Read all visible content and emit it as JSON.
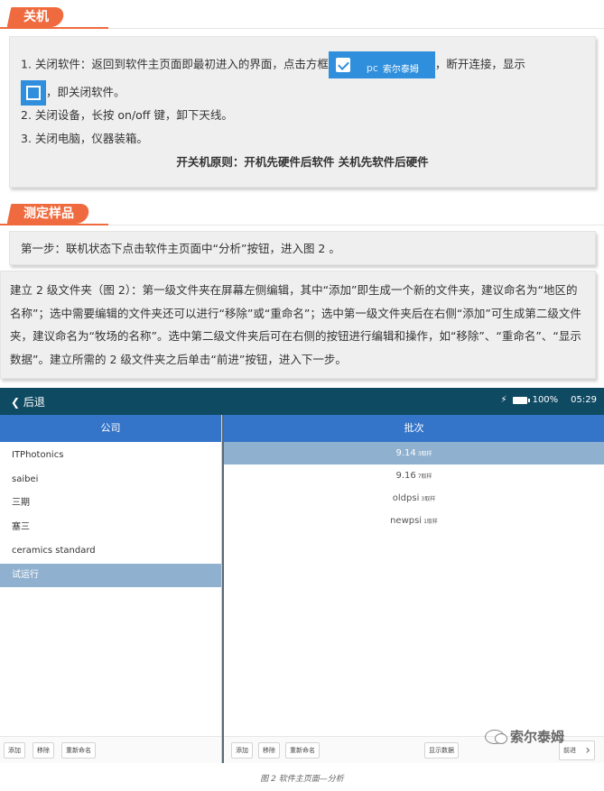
{
  "shutdown": {
    "heading": "关机",
    "step1_before": "1. 关闭软件：返回到软件主页面即最初进入的界面，点击方框",
    "step1_btn_text": "pc",
    "step1_watermark": "索尔泰姆",
    "step1_mid": "，断开连接，显示",
    "step1_after": "，即关闭软件。",
    "step2": "2. 关闭设备，长按 on/off 键，卸下天线。",
    "step3": "3. 关闭电脑，仪器装箱。",
    "principle": "开关机原则：开机先硬件后软件 关机先软件后硬件"
  },
  "measure": {
    "heading": "测定样品",
    "step1": "第一步：联机状态下点击软件主页面中“分析”按钮，进入图 2 。",
    "para": "建立 2 级文件夹（图 2）：第一级文件夹在屏幕左侧编辑，其中“添加”即生成一个新的文件夹，建议命名为“地区的名称”；选中需要编辑的文件夹还可以进行“移除”或“重命名”；选中第一级文件夹后在右侧“添加”可生成第二级文件夹，建议命名为“牧场的名称”。选中第二级文件夹后可在右侧的按钮进行编辑和操作，如“移除”、“重命名”、“显示数据”。建立所需的 2 级文件夹之后单击“前进”按钮，进入下一步。"
  },
  "app": {
    "back_label": "后退",
    "battery": "100%",
    "time": "05:29",
    "left_header": "公司",
    "right_header": "批次",
    "companies": [
      "ITPhotonics",
      "saibei",
      "三期",
      "塞三",
      "ceramics standard",
      "试运行"
    ],
    "batches": [
      {
        "name": "9.14",
        "count": "3取样"
      },
      {
        "name": "9.16",
        "count": "7取样"
      },
      {
        "name": "oldpsi",
        "count": "3取样"
      },
      {
        "name": "newpsi",
        "count": "1取样"
      }
    ],
    "left_buttons": [
      "添加",
      "移除",
      "重新命名"
    ],
    "right_buttons": [
      "添加",
      "移除",
      "重新命名"
    ],
    "show_data": "显示数据",
    "next": "前进"
  },
  "watermark": "索尔泰姆",
  "caption": "图 2  软件主页面—分析"
}
